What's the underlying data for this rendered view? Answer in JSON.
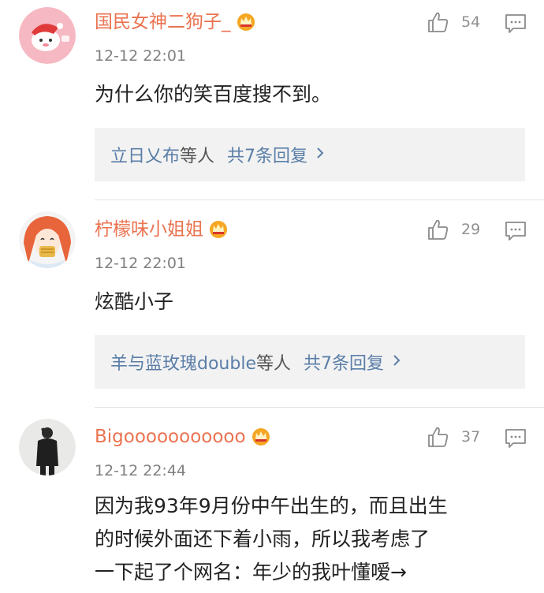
{
  "comments": [
    {
      "username": "国民女神二狗子_",
      "timestamp": "12-12 22:01",
      "likes": "54",
      "text": "为什么你的笑百度搜不到。",
      "replies": {
        "users": "立日乂布",
        "suffix": "等人",
        "count": "共7条回复"
      }
    },
    {
      "username": "柠檬味小姐姐",
      "timestamp": "12-12 22:01",
      "likes": "29",
      "text": "炫酷小子",
      "replies": {
        "users": "羊与蓝玫瑰double",
        "suffix": "等人",
        "count": "共7条回复"
      }
    },
    {
      "username": "Bigooooooooooo",
      "timestamp": "12-12 22:44",
      "likes": "37",
      "text_lines": [
        "因为我93年9月份中午出生的，而且出生",
        "的时候外面还下着小雨，所以我考虑了",
        "一下起了个网名：年少的我叶懂嗳→"
      ]
    }
  ],
  "colors": {
    "username": "#eb7350",
    "link": "#5a7ea8",
    "timestamp": "#808080",
    "reply_bg": "#f2f2f2",
    "crown": "#f5a623"
  },
  "icons": [
    "thumbs-up-icon",
    "comment-icon",
    "vip-crown-icon",
    "chevron-right-icon"
  ]
}
